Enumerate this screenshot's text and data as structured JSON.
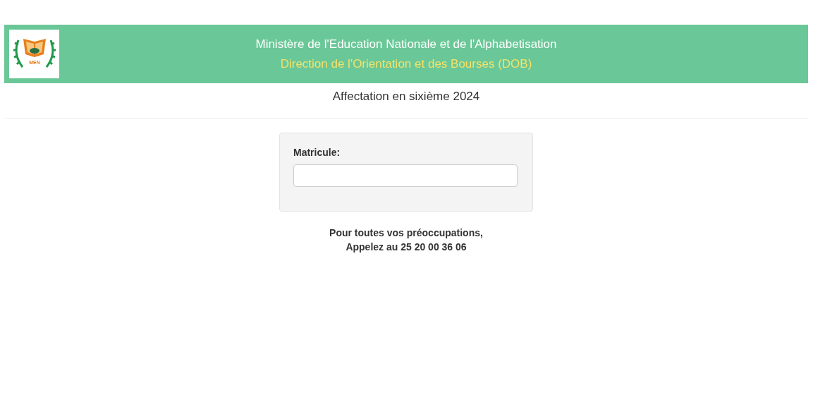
{
  "header": {
    "logo_text": "MEN",
    "title": "Ministère de l'Education Nationale et de l'Alphabetisation",
    "subtitle": "Direction de l'Orientation et des Bourses (DOB)"
  },
  "page_title": "Affectation en sixième 2024",
  "form": {
    "label": "Matricule:"
  },
  "footer_lines": [
    "Pour toutes vos préoccupations,",
    "Appelez au 25 20 00 36 06"
  ]
}
